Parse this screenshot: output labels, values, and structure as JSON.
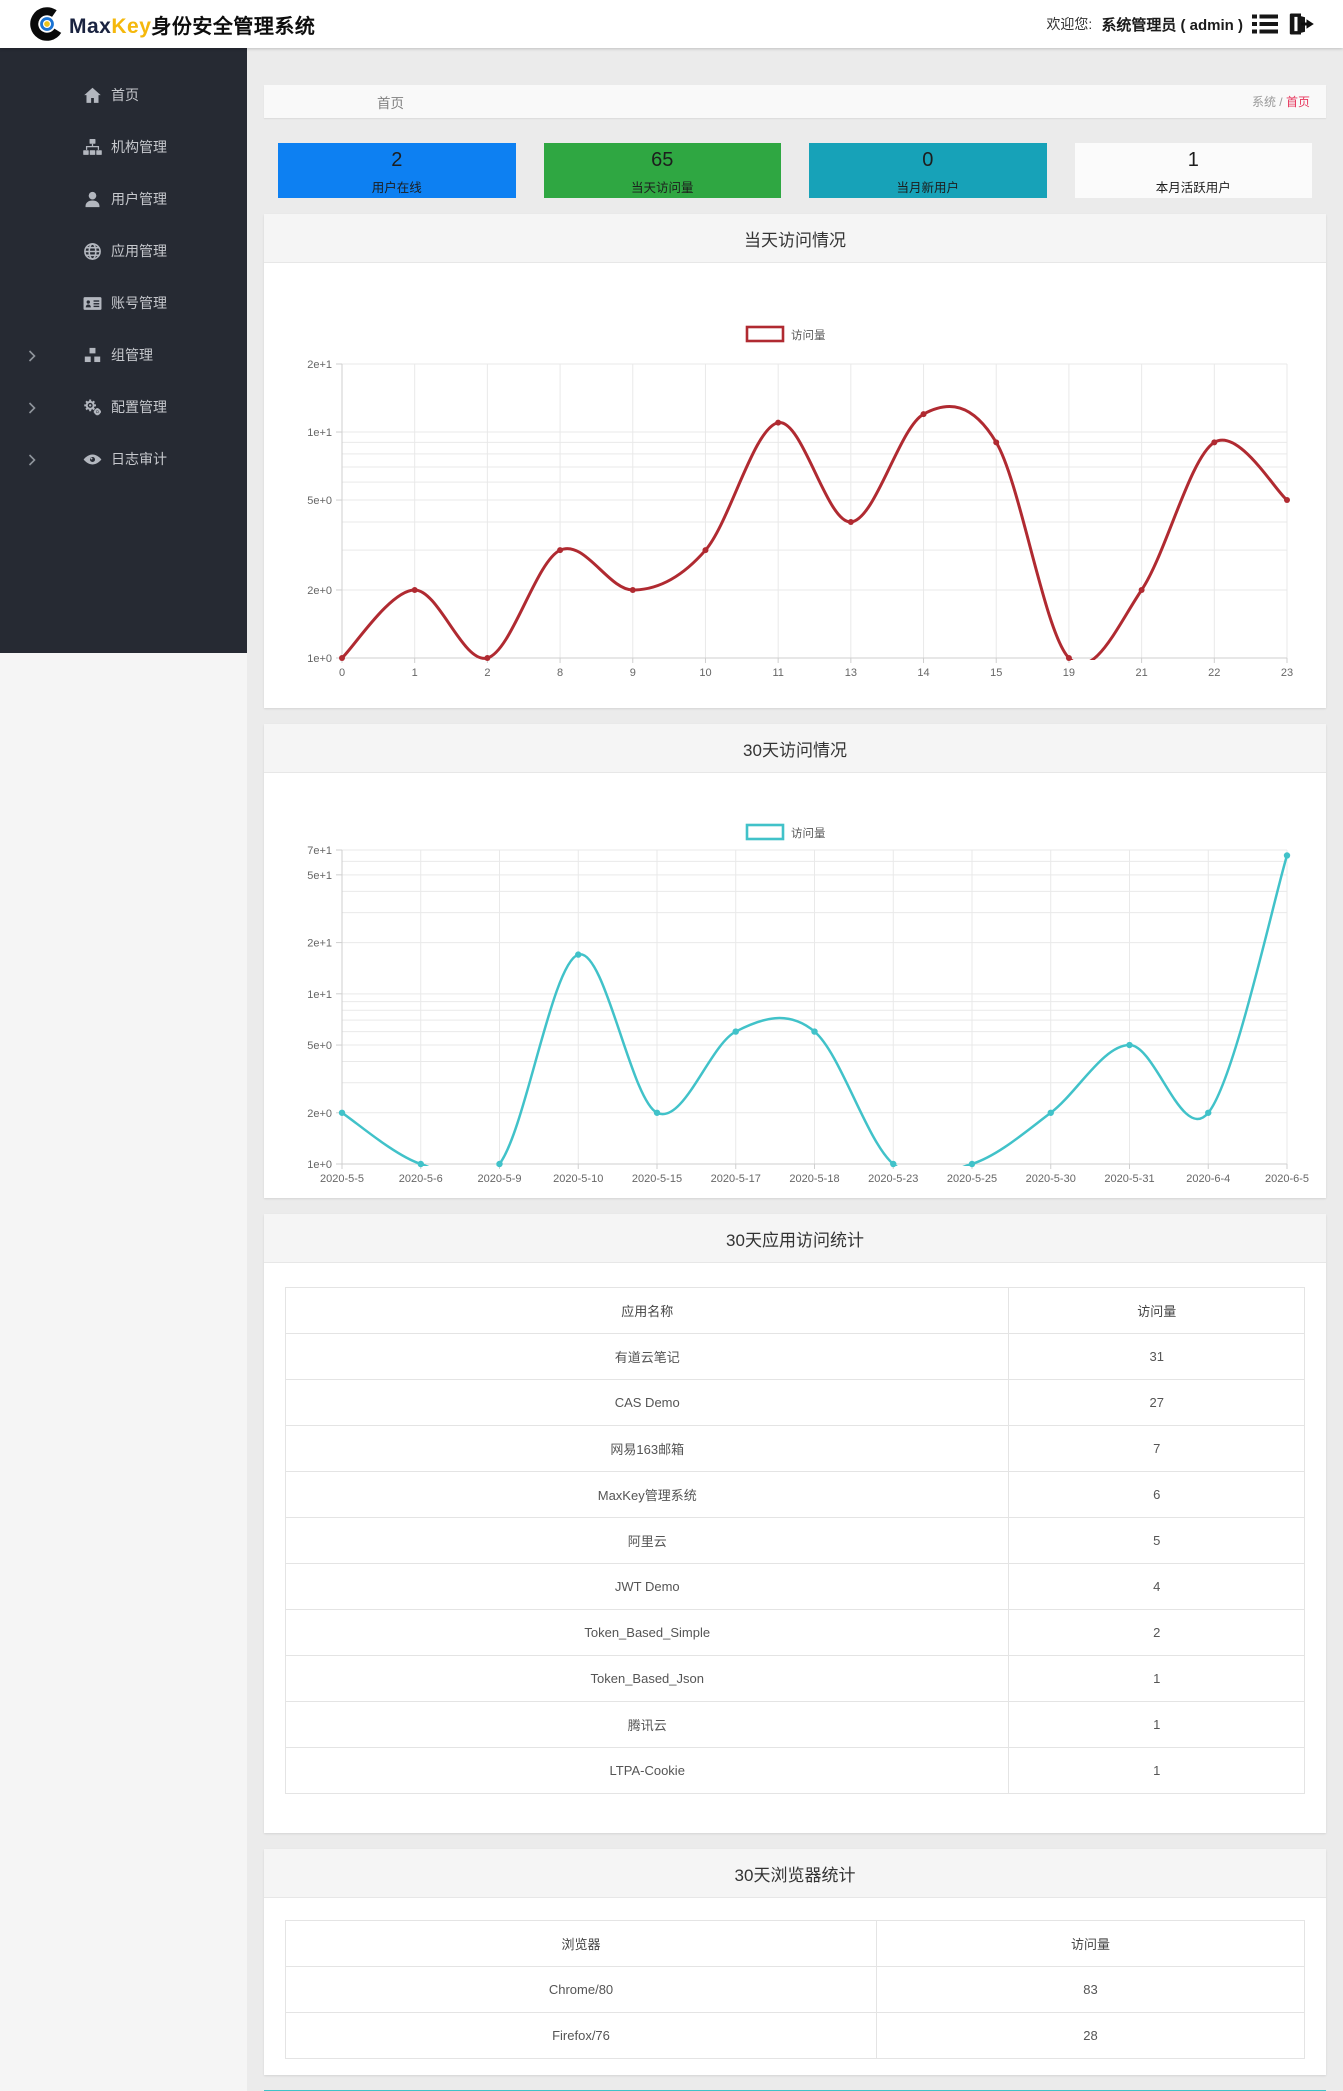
{
  "header": {
    "logo_max": "Max",
    "logo_key": "Key",
    "logo_suffix": "身份安全管理系统",
    "welcome_label": "欢迎您:",
    "user": "系统管理员 ( admin )"
  },
  "sidebar": {
    "items": [
      {
        "label": "首页",
        "icon": "home-icon",
        "expandable": false
      },
      {
        "label": "机构管理",
        "icon": "sitemap-icon",
        "expandable": false
      },
      {
        "label": "用户管理",
        "icon": "user-icon",
        "expandable": false
      },
      {
        "label": "应用管理",
        "icon": "globe-icon",
        "expandable": false
      },
      {
        "label": "账号管理",
        "icon": "id-card-icon",
        "expandable": false
      },
      {
        "label": "组管理",
        "icon": "cubes-icon",
        "expandable": true
      },
      {
        "label": "配置管理",
        "icon": "gears-icon",
        "expandable": true
      },
      {
        "label": "日志审计",
        "icon": "eye-icon",
        "expandable": true
      }
    ]
  },
  "breadcrumb": {
    "title": "首页",
    "section": "系统",
    "separator": " / ",
    "current": "首页"
  },
  "stat_cards": [
    {
      "value": "2",
      "label": "用户在线",
      "color": "#0d80f2",
      "text_color": "#1d1d1d"
    },
    {
      "value": "65",
      "label": "当天访问量",
      "color": "#2fa742",
      "text_color": "#1d1d1d"
    },
    {
      "value": "0",
      "label": "当月新用户",
      "color": "#17a2b8",
      "text_color": "#1d1d1d"
    },
    {
      "value": "1",
      "label": "本月活跃用户",
      "color": "#fbfbfb",
      "text_color": "#1d1d1d"
    }
  ],
  "panels": [
    {
      "title": "当天访问情况"
    },
    {
      "title": "30天访问情况"
    },
    {
      "title": "30天应用访问统计"
    },
    {
      "title": "30天浏览器统计"
    }
  ],
  "chart_data": [
    {
      "type": "line",
      "title": "当天访问情况",
      "legend": "访问量",
      "legend_position": "top",
      "color": "#b02a31",
      "y_scale": "log",
      "grid": true,
      "x": [
        "0",
        "1",
        "2",
        "8",
        "9",
        "10",
        "11",
        "13",
        "14",
        "15",
        "19",
        "21",
        "22",
        "23"
      ],
      "values": [
        1,
        2,
        1,
        3,
        2,
        3,
        11,
        4,
        12,
        9,
        1,
        2,
        9,
        5
      ],
      "ylim": [
        1,
        20
      ],
      "y_ticks": [
        {
          "label": "1e+0",
          "v": 1
        },
        {
          "label": "2e+0",
          "v": 2
        },
        {
          "label": "5e+0",
          "v": 5
        },
        {
          "label": "1e+1",
          "v": 10
        },
        {
          "label": "2e+1",
          "v": 20
        }
      ],
      "y_grid": [
        1,
        2,
        3,
        4,
        5,
        6,
        7,
        8,
        9,
        10,
        20
      ]
    },
    {
      "type": "line",
      "title": "30天访问情况",
      "legend": "访问量",
      "legend_position": "top",
      "color": "#41c2c9",
      "y_scale": "log",
      "grid": true,
      "x": [
        "2020-5-5",
        "2020-5-6",
        "2020-5-9",
        "2020-5-10",
        "2020-5-15",
        "2020-5-17",
        "2020-5-18",
        "2020-5-23",
        "2020-5-25",
        "2020-5-30",
        "2020-5-31",
        "2020-6-4",
        "2020-6-5"
      ],
      "values": [
        2,
        1,
        1,
        17,
        2,
        6,
        6,
        1,
        1,
        2,
        5,
        2,
        65
      ],
      "ylim": [
        1,
        70
      ],
      "y_ticks": [
        {
          "label": "1e+0",
          "v": 1
        },
        {
          "label": "2e+0",
          "v": 2
        },
        {
          "label": "5e+0",
          "v": 5
        },
        {
          "label": "1e+1",
          "v": 10
        },
        {
          "label": "2e+1",
          "v": 20
        },
        {
          "label": "5e+1",
          "v": 50
        },
        {
          "label": "7e+1",
          "v": 70
        }
      ],
      "y_grid": [
        1,
        2,
        3,
        4,
        5,
        6,
        7,
        8,
        9,
        10,
        20,
        30,
        40,
        50,
        60,
        70
      ]
    },
    {
      "type": "table",
      "title": "30天应用访问统计",
      "headers": [
        "应用名称",
        "访问量"
      ],
      "rows": [
        [
          "有道云笔记",
          "31"
        ],
        [
          "CAS Demo",
          "27"
        ],
        [
          "网易163邮箱",
          "7"
        ],
        [
          "MaxKey管理系统",
          "6"
        ],
        [
          "阿里云",
          "5"
        ],
        [
          "JWT Demo",
          "4"
        ],
        [
          "Token_Based_Simple",
          "2"
        ],
        [
          "Token_Based_Json",
          "1"
        ],
        [
          "腾讯云",
          "1"
        ],
        [
          "LTPA-Cookie",
          "1"
        ]
      ]
    },
    {
      "type": "table",
      "title": "30天浏览器统计",
      "headers": [
        "浏览器",
        "访问量"
      ],
      "rows": [
        [
          "Chrome/80",
          "83"
        ],
        [
          "Firefox/76",
          "28"
        ]
      ]
    }
  ]
}
